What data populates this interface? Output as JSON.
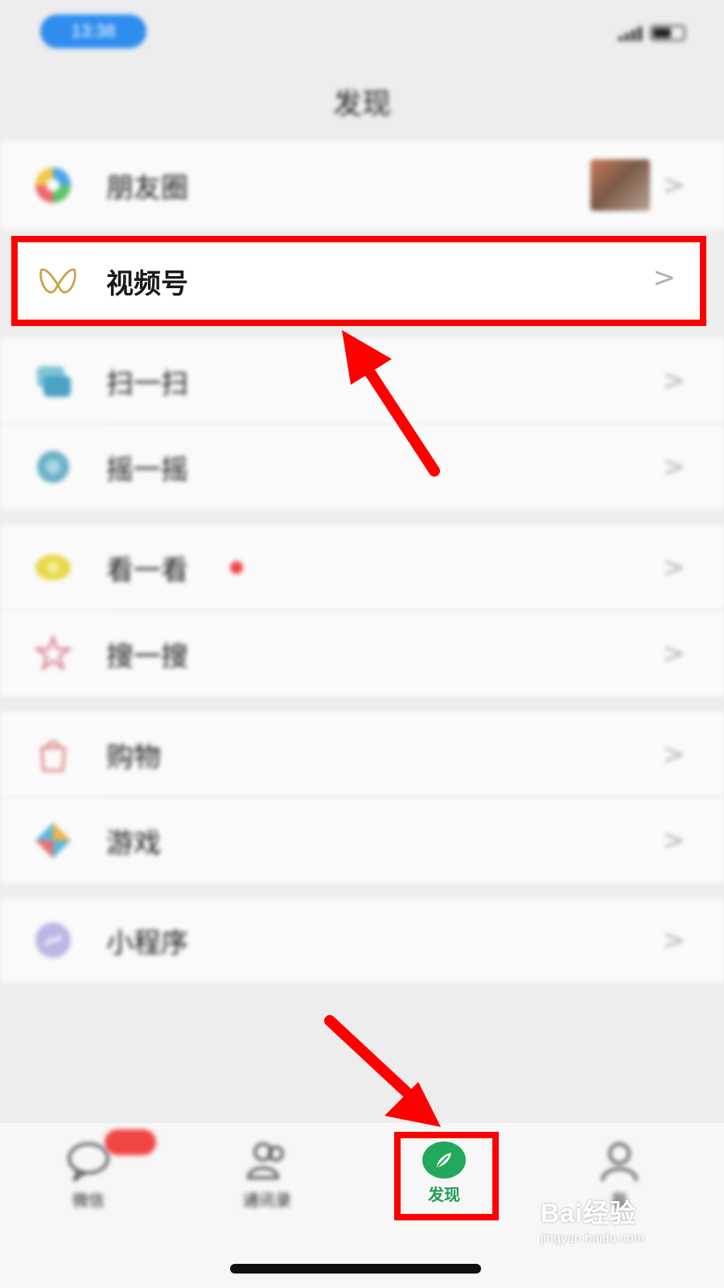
{
  "status_bar": {
    "time": "13:38"
  },
  "header": {
    "title": "发现"
  },
  "menu": [
    {
      "label": "朋友圈",
      "icon": "moments-icon"
    },
    {
      "label": "视频号",
      "icon": "channels-icon",
      "highlighted": true
    },
    {
      "label": "扫一扫",
      "icon": "scan-icon"
    },
    {
      "label": "摇一摇",
      "icon": "shake-icon"
    },
    {
      "label": "看一看",
      "icon": "top-stories-icon"
    },
    {
      "label": "搜一搜",
      "icon": "search-icon"
    },
    {
      "label": "购物",
      "icon": "shopping-icon"
    },
    {
      "label": "游戏",
      "icon": "games-icon"
    },
    {
      "label": "小程序",
      "icon": "mini-programs-icon"
    }
  ],
  "chevron": ">",
  "tabs": [
    {
      "label": "微信",
      "icon": "chat-icon"
    },
    {
      "label": "通讯录",
      "icon": "contacts-icon"
    },
    {
      "label": "发现",
      "icon": "compass-icon",
      "active": true
    },
    {
      "label": "我",
      "icon": "profile-icon"
    }
  ],
  "badge": {
    "text": ""
  },
  "watermark": {
    "main": "Bai经验",
    "sub": "jingyan.baidu.com"
  },
  "colors": {
    "highlight": "#ff0000",
    "active_tab": "#21a85c",
    "badge": "#f04545"
  }
}
